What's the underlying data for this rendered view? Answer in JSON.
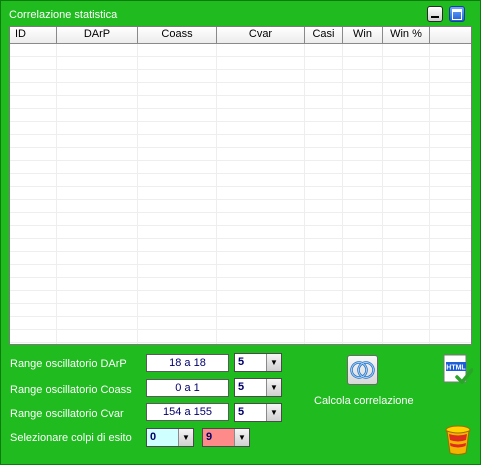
{
  "window": {
    "title": "Correlazione statistica"
  },
  "table": {
    "columns": [
      "ID",
      "DArP",
      "Coass",
      "Cvar",
      "Casi",
      "Win",
      "Win %",
      ""
    ],
    "rows": []
  },
  "params": [
    {
      "label": "Range oscillatorio DArP",
      "range": "18 a 18",
      "combo": "5"
    },
    {
      "label": "Range oscillatorio Coass",
      "range": "0 a 1",
      "combo": "5"
    },
    {
      "label": "Range oscillatorio Cvar",
      "range": "154 a 155",
      "combo": "5"
    }
  ],
  "esito": {
    "label": "Selezionare colpi di esito",
    "from": "0",
    "to": "9",
    "from_color": "#cfffff",
    "to_color": "#ff8a8a"
  },
  "actions": {
    "calcola_label": "Calcola correlazione"
  },
  "icons": {
    "minimize": "minimize-icon",
    "maximize": "maximize-icon",
    "calc": "correlation-rings-icon",
    "html": "html-export-icon",
    "trash": "trash-icon"
  },
  "colors": {
    "window_bg": "#1fbb1f",
    "label_text": "#ffffff",
    "value_text": "#00006a"
  }
}
